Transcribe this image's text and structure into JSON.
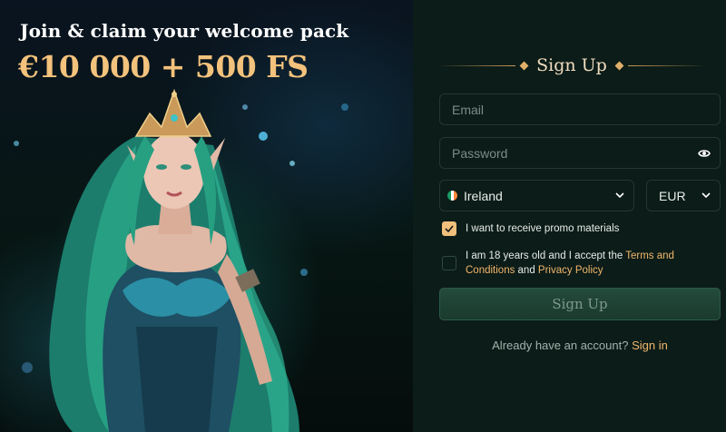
{
  "promo": {
    "title": "Join & claim your welcome pack",
    "amount": "€10 000 + 500 FS"
  },
  "form": {
    "heading": "Sign Up",
    "email_placeholder": "Email",
    "password_placeholder": "Password",
    "country": "Ireland",
    "currency": "EUR",
    "promo_checkbox": {
      "label": "I want to receive promo materials",
      "checked": true
    },
    "terms_checkbox": {
      "checked": false,
      "text_before": "I am 18 years old and I accept the ",
      "terms_link": "Terms and Conditions",
      "text_middle": " and ",
      "privacy_link": "Privacy Policy"
    },
    "submit_label": "Sign Up",
    "signin_prompt": "Already have an account?",
    "signin_link": "Sign in"
  },
  "colors": {
    "accent": "#f0c07c",
    "panel_bg": "#0c1c18",
    "promo_amount": "#f3c27c"
  },
  "icons": [
    "eye-icon",
    "chevron-down-icon",
    "ireland-flag-icon",
    "check-icon",
    "diamond-ornament"
  ]
}
